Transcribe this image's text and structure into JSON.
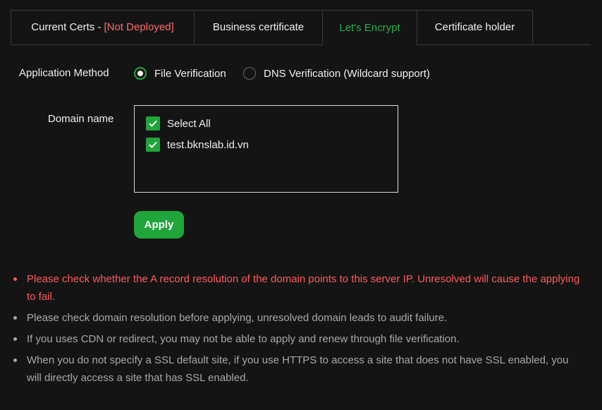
{
  "tabs": [
    {
      "label": "Current Certs -",
      "warning": "[Not Deployed]"
    },
    {
      "label": "Business certificate"
    },
    {
      "label": "Let's Encrypt"
    },
    {
      "label": "Certificate holder"
    }
  ],
  "form": {
    "method_label": "Application Method",
    "methods": [
      {
        "label": "File Verification",
        "checked": true
      },
      {
        "label": "DNS Verification (Wildcard support)",
        "checked": false
      }
    ],
    "domain_label": "Domain name",
    "select_all": "Select All",
    "domains": [
      "test.bknslab.id.vn"
    ],
    "apply": "Apply"
  },
  "tips": [
    "Please check whether the A record resolution of the domain points to this server IP. Unresolved will cause the applying to fail.",
    "Please check domain resolution before applying, unresolved domain leads to audit failure.",
    "If you uses CDN or redirect, you may not be able to apply and renew through file verification.",
    "When you do not specify a SSL default site, if you use HTTPS to access a site that does not have SSL enabled, you will directly access a site that has SSL enabled."
  ],
  "colors": {
    "accent": "#20a53a",
    "active_tab": "#2ab04a",
    "danger": "#ff5a5a",
    "background": "#141414"
  }
}
